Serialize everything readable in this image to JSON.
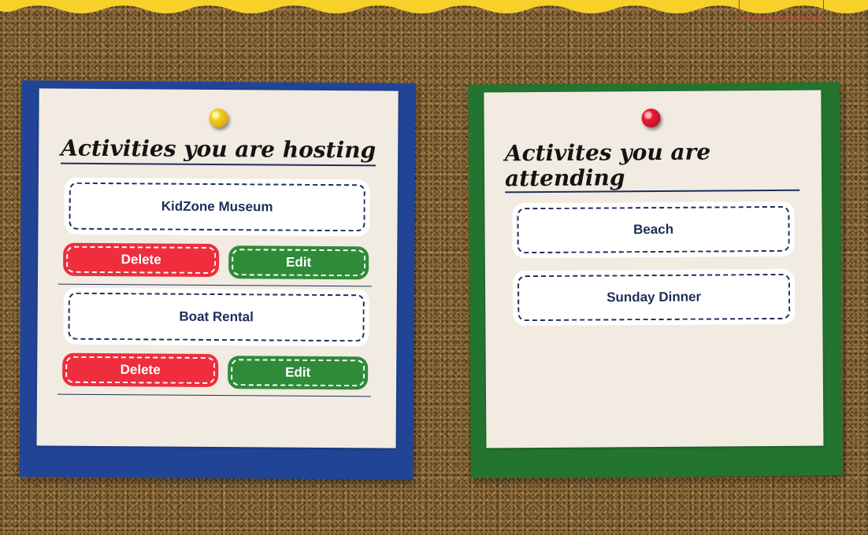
{
  "hosting": {
    "title": "Activities you are hosting",
    "activities": [
      {
        "name": "KidZone Museum",
        "delete_label": "Delete",
        "edit_label": "Edit"
      },
      {
        "name": "Boat Rental",
        "delete_label": "Delete",
        "edit_label": "Edit"
      }
    ]
  },
  "attending": {
    "title": "Activites you are attending",
    "activities": [
      {
        "name": "Beach"
      },
      {
        "name": "Sunday Dinner"
      }
    ]
  },
  "colors": {
    "hosting_frame": "#214496",
    "attending_frame": "#23742f",
    "delete_button": "#ef2d3c",
    "edit_button": "#2f8b38",
    "banner": "#f7d02a",
    "paper": "#f1ebe1",
    "text_navy": "#1d2e5a"
  },
  "icons": {
    "hosting_pin": "yellow-pushpin-icon",
    "attending_pin": "red-pushpin-icon"
  }
}
